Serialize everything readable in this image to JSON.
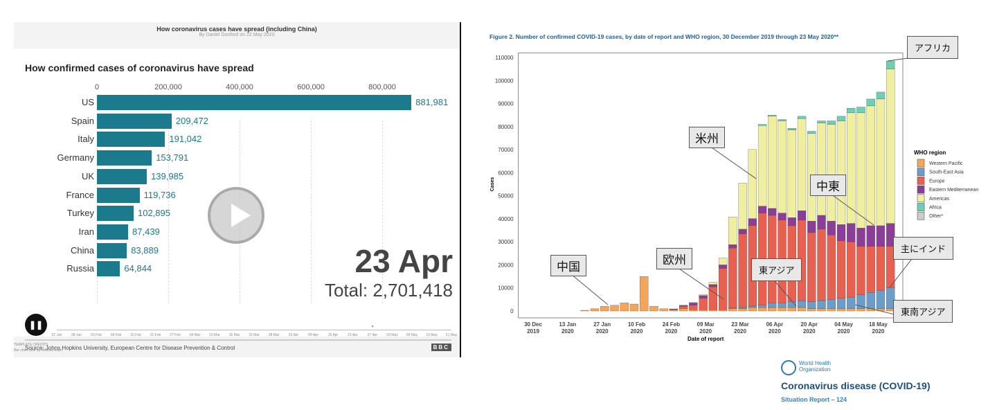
{
  "left_panel": {
    "header_title": "How coronavirus cases have spread (including China)",
    "byline": "By Daniel Dunford on 22 May 2020",
    "current_date": "23 Apr",
    "total": "Total: 2,701,418",
    "pause_icon": "pause-icon",
    "play_icon": "play-icon",
    "timeline": [
      "22 Jan",
      "28 Jan",
      "03 Feb",
      "09 Feb",
      "15 Feb",
      "21 Feb",
      "27 Feb",
      "04 Mar",
      "10 Mar",
      "16 Mar",
      "22 Mar",
      "28 Mar",
      "03 Apr",
      "09 Apr",
      "15 Apr",
      "21 Apr",
      "27 Apr",
      "03 May",
      "09 May",
      "15 May",
      "21 May"
    ],
    "timeline_position": 0.8,
    "source": "Source: Johns Hopkins University, European Centre for Disease Prevention & Control",
    "bbc": "BBC",
    "credits_heading": "TEMPLATE CREDITS",
    "credits_text": "Bar chart race by Flourish team"
  },
  "right_panel": {
    "who_org": "World Health Organization",
    "report_title": "Coronavirus disease (COVID-19)",
    "report_subtitle": "Situation Report – 124",
    "callouts": [
      {
        "text": "アフリカ",
        "target": "Africa"
      },
      {
        "text": "米州",
        "target": "Americas"
      },
      {
        "text": "中東",
        "target": "Eastern Mediterranean"
      },
      {
        "text": "主にインド",
        "target": "South-East Asia"
      },
      {
        "text": "中国",
        "target": "Western Pacific"
      },
      {
        "text": "欧州",
        "target": "Europe"
      },
      {
        "text": "東アジア",
        "target": "Western Pacific"
      },
      {
        "text": "東南アジア",
        "target": "South-East Asia"
      }
    ]
  },
  "chart_data": [
    {
      "type": "bar",
      "title": "How confirmed cases of coronavirus have spread",
      "orientation": "horizontal",
      "categories": [
        "US",
        "Spain",
        "Italy",
        "Germany",
        "UK",
        "France",
        "Turkey",
        "Iran",
        "China",
        "Russia"
      ],
      "values": [
        881981,
        209472,
        191042,
        153791,
        139985,
        119736,
        102895,
        87439,
        83889,
        64844
      ],
      "value_labels": [
        "881,981",
        "209,472",
        "191,042",
        "153,791",
        "139,985",
        "119,736",
        "102,895",
        "87,439",
        "83,889",
        "64,844"
      ],
      "xticks": [
        0,
        200000,
        400000,
        600000,
        800000
      ],
      "xtick_labels": [
        "0",
        "200,000",
        "400,000",
        "600,000",
        "800,000"
      ],
      "color": "#1b7a8c"
    },
    {
      "type": "bar",
      "stacked": true,
      "title": "Figure 2. Number of confirmed COVID-19 cases, by date of report and WHO region, 30 December 2019 through 23 May 2020**",
      "xlabel": "Date of report",
      "ylabel": "Cases",
      "ylim": [
        0,
        110000
      ],
      "yticks": [
        0,
        10000,
        20000,
        30000,
        40000,
        50000,
        60000,
        70000,
        80000,
        90000,
        100000,
        110000
      ],
      "xticks_day": [
        0,
        14,
        28,
        42,
        56,
        70,
        84,
        98,
        112,
        126,
        140
      ],
      "xtick_labels": [
        [
          "30 Dec",
          "2019"
        ],
        [
          "13 Jan",
          "2020"
        ],
        [
          "27 Jan",
          "2020"
        ],
        [
          "10 Feb",
          "2020"
        ],
        [
          "24 Feb",
          "2020"
        ],
        [
          "09 Mar",
          "2020"
        ],
        [
          "23 Mar",
          "2020"
        ],
        [
          "06 Apr",
          "2020"
        ],
        [
          "20 Apr",
          "2020"
        ],
        [
          "04 May",
          "2020"
        ],
        [
          "18 May",
          "2020"
        ]
      ],
      "legend_title": "WHO region",
      "legend_position": "right",
      "x_day": [
        21,
        25,
        29,
        33,
        37,
        41,
        45,
        49,
        53,
        57,
        61,
        65,
        69,
        73,
        77,
        81,
        85,
        89,
        93,
        97,
        101,
        105,
        109,
        113,
        117,
        121,
        125,
        129,
        133,
        137,
        141,
        145
      ],
      "series": [
        {
          "name": "Western Pacific",
          "color": "#f5a55a",
          "values": [
            300,
            1000,
            2000,
            2500,
            3500,
            3000,
            15000,
            2000,
            1000,
            500,
            1000,
            500,
            500,
            500,
            500,
            1000,
            1000,
            1500,
            1500,
            1500,
            1500,
            1500,
            1500,
            1000,
            1000,
            1000,
            1000,
            1000,
            1000,
            1000,
            1000,
            1000
          ]
        },
        {
          "name": "South-East Asia",
          "color": "#6a9ec8",
          "values": [
            0,
            0,
            0,
            0,
            0,
            0,
            0,
            0,
            0,
            0,
            0,
            0,
            0,
            0,
            0,
            300,
            500,
            600,
            1000,
            2000,
            2000,
            2500,
            3000,
            3000,
            3500,
            4000,
            4500,
            5000,
            6000,
            7000,
            8000,
            9000
          ]
        },
        {
          "name": "Europe",
          "color": "#e8604f",
          "values": [
            0,
            0,
            0,
            0,
            0,
            0,
            0,
            0,
            0,
            200,
            1000,
            2000,
            5000,
            10000,
            18000,
            26000,
            32000,
            35000,
            40000,
            38000,
            36000,
            33000,
            35000,
            30000,
            31000,
            28000,
            25000,
            24000,
            21000,
            20000,
            19000,
            18000
          ]
        },
        {
          "name": "Eastern Mediterranean",
          "color": "#8a3e98",
          "values": [
            0,
            0,
            0,
            0,
            0,
            0,
            0,
            0,
            0,
            200,
            500,
            1000,
            1200,
            1000,
            1500,
            1500,
            2000,
            3000,
            3000,
            3000,
            3000,
            3500,
            4000,
            5000,
            6000,
            6000,
            7000,
            8000,
            8000,
            9000,
            9000,
            10000
          ]
        },
        {
          "name": "Americas",
          "color": "#f0efa0",
          "values": [
            0,
            0,
            0,
            0,
            0,
            0,
            0,
            0,
            0,
            0,
            0,
            200,
            500,
            1000,
            3000,
            12000,
            20000,
            30000,
            35000,
            40000,
            40000,
            38000,
            40000,
            38000,
            40000,
            42000,
            45000,
            48000,
            50000,
            52000,
            55000,
            67000
          ]
        },
        {
          "name": "Africa",
          "color": "#6fcfb5",
          "values": [
            0,
            0,
            0,
            0,
            0,
            0,
            0,
            0,
            0,
            0,
            0,
            0,
            0,
            0,
            0,
            0,
            0,
            0,
            500,
            500,
            600,
            800,
            1000,
            1000,
            1000,
            1500,
            2000,
            2000,
            2500,
            3000,
            3000,
            3500
          ]
        },
        {
          "name": "Other*",
          "color": "#cccccc",
          "values": [
            0,
            0,
            0,
            0,
            0,
            0,
            0,
            0,
            0,
            0,
            0,
            0,
            0,
            0,
            0,
            0,
            0,
            0,
            0,
            0,
            0,
            0,
            0,
            0,
            0,
            0,
            0,
            0,
            0,
            0,
            0,
            0
          ]
        }
      ]
    }
  ]
}
